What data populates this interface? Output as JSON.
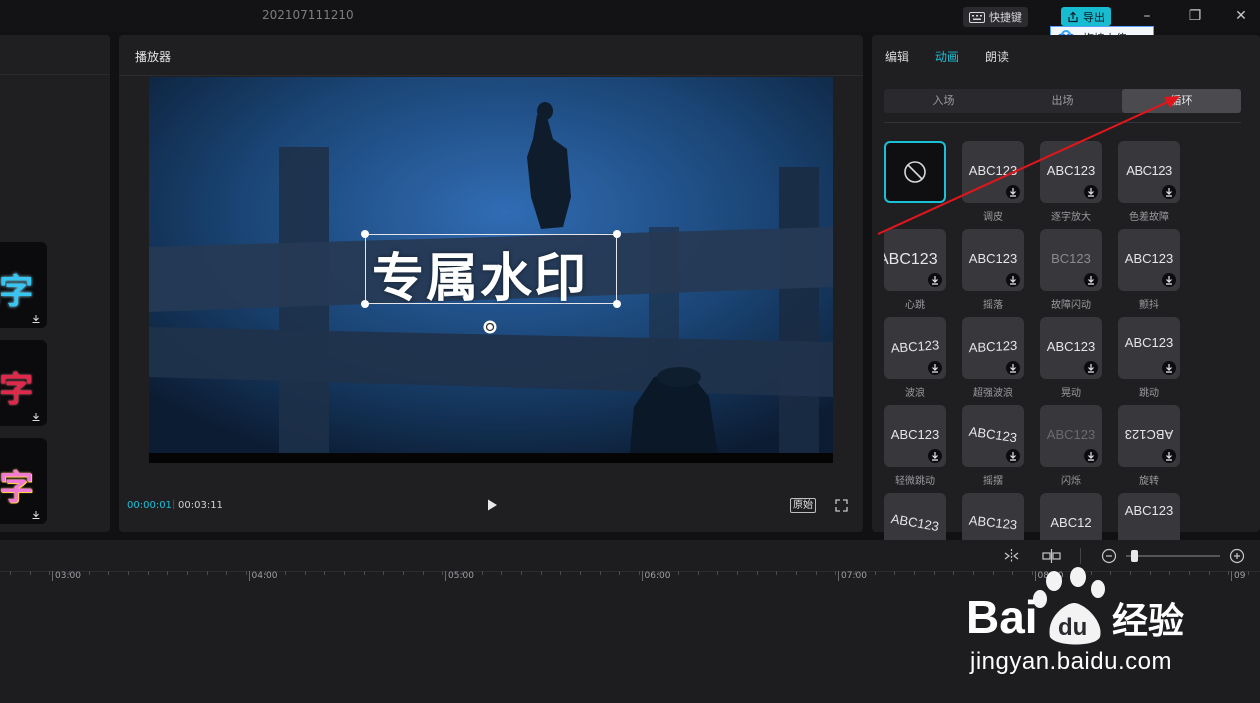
{
  "title_bar": {
    "project_name": "202107111210",
    "shortcuts_label": "快捷键",
    "export_label": "导出",
    "upload_popup_label": "拖拽上传"
  },
  "player": {
    "title": "播放器",
    "overlay_text": "专属水印",
    "current_time": "00:00:01",
    "separator": "|",
    "total_time": "00:03:11",
    "original_label": "原始"
  },
  "right_panel": {
    "tabs": [
      {
        "label": "编辑",
        "active": false
      },
      {
        "label": "动画",
        "active": true
      },
      {
        "label": "朗读",
        "active": false
      }
    ],
    "subtabs": [
      {
        "label": "入场",
        "active": false
      },
      {
        "label": "出场",
        "active": false
      },
      {
        "label": "循环",
        "active": true
      }
    ],
    "animations": [
      {
        "sample": "ABC123",
        "label": "调皮"
      },
      {
        "sample": "ABC123",
        "label": "逐字放大"
      },
      {
        "sample": "ABC123",
        "label": "色差故障"
      },
      {
        "sample": "ABC123",
        "label": "心跳"
      },
      {
        "sample": "ABC123",
        "label": "摇落"
      },
      {
        "sample": "BC123",
        "label": "故障闪动"
      },
      {
        "sample": "ABC123",
        "label": "颤抖"
      },
      {
        "sample": "ABC123",
        "label": "波浪"
      },
      {
        "sample": "ABC123",
        "label": "超强波浪"
      },
      {
        "sample": "ABC123",
        "label": "晃动"
      },
      {
        "sample": "ABC123",
        "label": "跳动"
      },
      {
        "sample": "ABC123",
        "label": "轻微跳动"
      },
      {
        "sample": "ABC123",
        "label": "摇摆"
      },
      {
        "sample": "ABC123",
        "label": "闪烁"
      },
      {
        "sample": "ABC123",
        "label": "旋转"
      },
      {
        "sample": "ABC123",
        "label": ""
      },
      {
        "sample": "ABC123",
        "label": ""
      },
      {
        "sample": "ABC12",
        "label": ""
      },
      {
        "sample": "ABC123",
        "label": ""
      }
    ]
  },
  "left_panel": {
    "cards": [
      {
        "glyph": "E字",
        "color": "#39c5f2"
      },
      {
        "glyph": "E字",
        "color": "#e0294a"
      },
      {
        "glyph": "E字",
        "color": "#f07ad6"
      }
    ]
  },
  "timeline": {
    "ticks": [
      "03:00",
      "04:00",
      "05:00",
      "06:00",
      "07:00",
      "08:00",
      "09"
    ]
  },
  "watermark": {
    "logo_text": "Bai",
    "logo_du": "du",
    "logo_cn": "经验",
    "url": "jingyan.baidu.com"
  },
  "colors": {
    "accent": "#19c1d7",
    "arrow": "#e0161b"
  }
}
